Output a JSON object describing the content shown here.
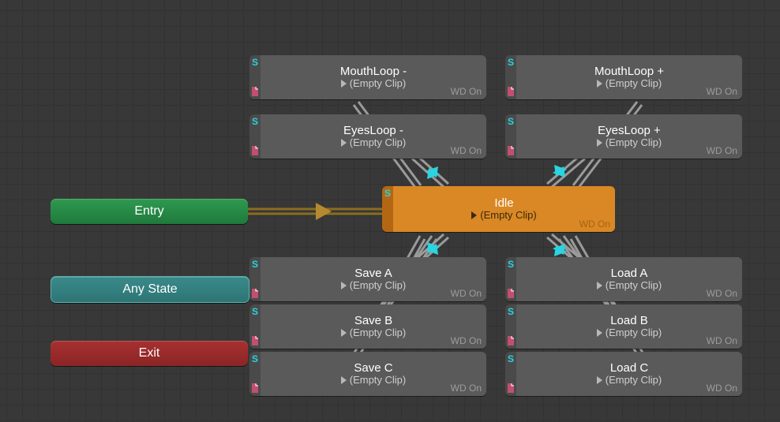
{
  "system": {
    "entry": "Entry",
    "any_state": "Any State",
    "exit": "Exit"
  },
  "badges": {
    "sync": "S",
    "wd": "WD On"
  },
  "states": {
    "idle": {
      "name": "Idle",
      "clip": "(Empty Clip)"
    },
    "mouth_minus": {
      "name": "MouthLoop -",
      "clip": "(Empty Clip)"
    },
    "mouth_plus": {
      "name": "MouthLoop +",
      "clip": "(Empty Clip)"
    },
    "eyes_minus": {
      "name": "EyesLoop -",
      "clip": "(Empty Clip)"
    },
    "eyes_plus": {
      "name": "EyesLoop +",
      "clip": "(Empty Clip)"
    },
    "save_a": {
      "name": "Save A",
      "clip": "(Empty Clip)"
    },
    "save_b": {
      "name": "Save B",
      "clip": "(Empty Clip)"
    },
    "save_c": {
      "name": "Save C",
      "clip": "(Empty Clip)"
    },
    "load_a": {
      "name": "Load A",
      "clip": "(Empty Clip)"
    },
    "load_b": {
      "name": "Load B",
      "clip": "(Empty Clip)"
    },
    "load_c": {
      "name": "Load C",
      "clip": "(Empty Clip)"
    }
  },
  "default_state": "idle",
  "transitions": [
    {
      "from": "Entry",
      "to": "Idle"
    },
    {
      "from": "Idle",
      "to": "MouthLoop -"
    },
    {
      "from": "MouthLoop -",
      "to": "Idle"
    },
    {
      "from": "Idle",
      "to": "MouthLoop +"
    },
    {
      "from": "MouthLoop +",
      "to": "Idle"
    },
    {
      "from": "Idle",
      "to": "EyesLoop -"
    },
    {
      "from": "EyesLoop -",
      "to": "Idle"
    },
    {
      "from": "Idle",
      "to": "EyesLoop +"
    },
    {
      "from": "EyesLoop +",
      "to": "Idle"
    },
    {
      "from": "Idle",
      "to": "Save A"
    },
    {
      "from": "Save A",
      "to": "Idle"
    },
    {
      "from": "Idle",
      "to": "Save B"
    },
    {
      "from": "Save B",
      "to": "Idle"
    },
    {
      "from": "Idle",
      "to": "Save C"
    },
    {
      "from": "Save C",
      "to": "Idle"
    },
    {
      "from": "Idle",
      "to": "Load A"
    },
    {
      "from": "Load A",
      "to": "Idle"
    },
    {
      "from": "Idle",
      "to": "Load B"
    },
    {
      "from": "Load B",
      "to": "Idle"
    },
    {
      "from": "Idle",
      "to": "Load C"
    },
    {
      "from": "Load C",
      "to": "Idle"
    }
  ]
}
